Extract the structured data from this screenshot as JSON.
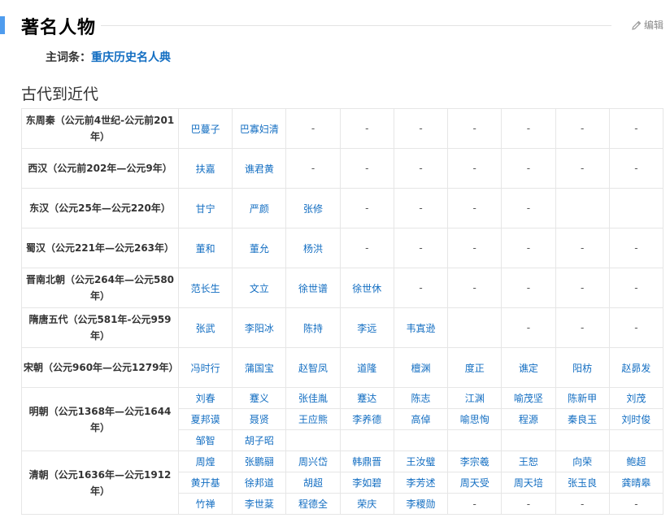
{
  "section": {
    "title": "著名人物",
    "edit_label": "编辑",
    "edit_icon": "pencil-icon"
  },
  "lead": {
    "label": "主词条：",
    "link": "重庆历史名人典"
  },
  "subsection": {
    "title": "古代到近代"
  },
  "eras": [
    {
      "label": "东周秦（公元前4世纪-公元前201年）",
      "rows": [
        [
          "巴蔓子",
          "巴寡妇清",
          "-",
          "-",
          "-",
          "-",
          "-",
          "-",
          "-"
        ]
      ]
    },
    {
      "label": "西汉（公元前202年—公元9年）",
      "rows": [
        [
          "扶嘉",
          "谯君黄",
          "-",
          "-",
          "-",
          "-",
          "-",
          "-",
          "-"
        ]
      ]
    },
    {
      "label": "东汉（公元25年—公元220年）",
      "rows": [
        [
          "甘宁",
          "严颜",
          "张修",
          "-",
          "-",
          "-",
          "-",
          "",
          ""
        ]
      ]
    },
    {
      "label": "蜀汉（公元221年—公元263年）",
      "rows": [
        [
          "董和",
          "董允",
          "杨洪",
          "-",
          "-",
          "-",
          "-",
          "-",
          "-"
        ]
      ]
    },
    {
      "label": "晋南北朝（公元264年—公元580年）",
      "rows": [
        [
          "范长生",
          "文立",
          "徐世谱",
          "徐世休",
          "-",
          "-",
          "-",
          "-",
          "-"
        ]
      ]
    },
    {
      "label": "隋唐五代（公元581年-公元959年）",
      "rows": [
        [
          "张武",
          "李阳冰",
          "陈持",
          "李远",
          "韦寘逊",
          "",
          "-",
          "-",
          "-"
        ]
      ]
    },
    {
      "label": "宋朝（公元960年—公元1279年）",
      "rows": [
        [
          "冯时行",
          "蒲国宝",
          "赵智凤",
          "道隆",
          "檀渊",
          "度正",
          "谯定",
          "阳枋",
          "赵昴发"
        ]
      ]
    },
    {
      "label": "明朝（公元1368年—公元1644年）",
      "rows": [
        [
          "刘春",
          "蹇义",
          "张佳胤",
          "蹇达",
          "陈志",
          "江渊",
          "喻茂坚",
          "陈新甲",
          "刘茂"
        ],
        [
          "夏邦谟",
          "聂贤",
          "王应熊",
          "李养德",
          "高倬",
          "喻思恂",
          "程源",
          "秦良玉",
          "刘时俊"
        ],
        [
          "邹智",
          "胡子昭",
          "",
          "",
          "",
          "",
          "",
          "",
          ""
        ]
      ]
    },
    {
      "label": "清朝（公元1636年—公元1912年）",
      "rows": [
        [
          "周煌",
          "张鹏翮",
          "周兴岱",
          "韩鼎晋",
          "王汝璧",
          "李宗羲",
          "王恕",
          "向荣",
          "鲍超"
        ],
        [
          "黄开基",
          "徐邦道",
          "胡超",
          "李如碧",
          "李芳述",
          "周天受",
          "周天培",
          "张玉良",
          "龚晴皋"
        ],
        [
          "竹禅",
          "李世棻",
          "程德全",
          "荣庆",
          "李稷勋",
          "-",
          "-",
          "-",
          "-"
        ]
      ]
    }
  ]
}
